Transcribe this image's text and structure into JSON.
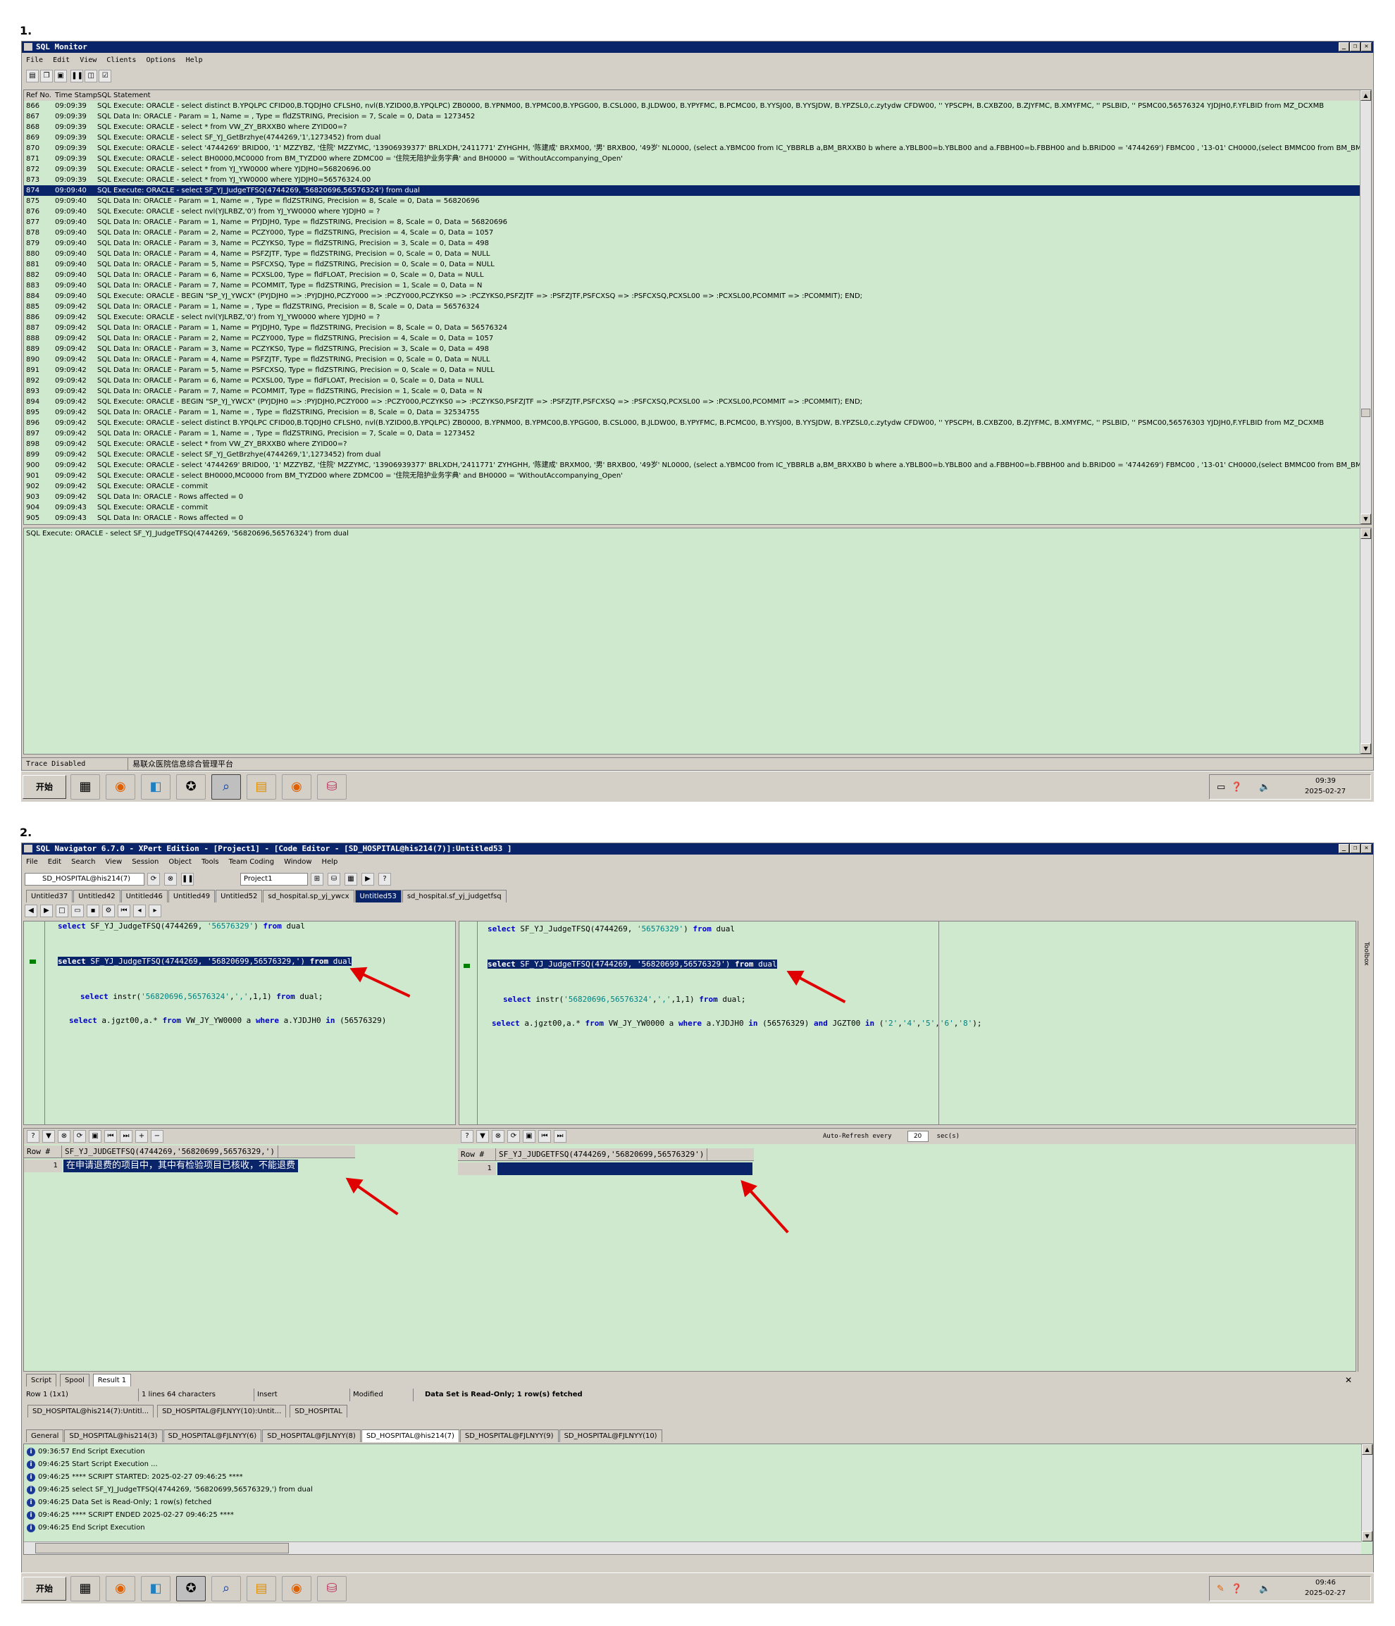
{
  "labels": {
    "one": "1.",
    "two": "2."
  },
  "monitor": {
    "title": "SQL Monitor",
    "menu": [
      "File",
      "Edit",
      "View",
      "Clients",
      "Options",
      "Help"
    ],
    "headers": [
      "Ref No.",
      "Time Stamp",
      "SQL Statement"
    ],
    "rows": [
      [
        "866",
        "09:09:39",
        "SQL Execute: ORACLE -    select distinct B.YPQLPC CFID00,B.TQDJH0 CFLSH0, nvl(B.YZID00,B.YPQLPC) ZB0000, B.YPNM00,   B.YPMC00,B.YPGG00, B.CSL000, B.JLDW00, B.YPYFMC, B.PCMC00, B.YYSJ00, B.YYSJDW,   B.YPZSL0,c.zytydw CFDW00, '' YPSCPH, B.CXBZ00, B.ZJYFMC, B.XMYFMC, '' PSLBID, '' PSMC00,56576324 YJDJH0,F.YFLBID   from MZ_DCXMB"
      ],
      [
        "867",
        "09:09:39",
        "SQL Data In: ORACLE - Param = 1, Name = , Type = fldZSTRING, Precision = 7, Scale = 0, Data = 1273452"
      ],
      [
        "868",
        "09:09:39",
        "SQL Execute: ORACLE - select * from VW_ZY_BRXXB0 where ZYID00=?"
      ],
      [
        "869",
        "09:09:39",
        "SQL Execute: ORACLE - select SF_YJ_GetBrzhye(4744269,'1',1273452) from dual"
      ],
      [
        "870",
        "09:09:39",
        "SQL Execute: ORACLE - select '4744269' BRID00, '1' MZZYBZ, '住院' MZZYMC, '13906939377' BRLXDH,'2411771' ZYHGHH, '陈建成' BRXM00, '男' BRXB00, '49岁' NL0000, (select a.YBMC00 from IC_YBBRLB a,BM_BRXXB0 b where a.YBLB00=b.YBLB00 and a.FBBH00=b.FBBH00 and b.BRID00 = '4744269') FBMC00 , '13-01' CH0000,(select BMMC00 from BM_BMBM00"
      ],
      [
        "871",
        "09:09:39",
        "SQL Execute: ORACLE - select BH0000,MC0000 from BM_TYZD00 where ZDMC00 = '住院无陪护业务字典' and BH0000 = 'WithoutAccompanying_Open'"
      ],
      [
        "872",
        "09:09:39",
        "SQL Execute: ORACLE - select * from YJ_YW0000 where YJDJH0=56820696.00"
      ],
      [
        "873",
        "09:09:39",
        "SQL Execute: ORACLE - select * from YJ_YW0000 where YJDJH0=56576324.00"
      ],
      [
        "874",
        "09:09:40",
        "SQL Execute: ORACLE - select SF_YJ_JudgeTFSQ(4744269, '56820696,56576324') from dual"
      ],
      [
        "875",
        "09:09:40",
        "SQL Data In: ORACLE - Param = 1, Name = , Type = fldZSTRING, Precision = 8, Scale = 0, Data = 56820696"
      ],
      [
        "876",
        "09:09:40",
        "SQL Execute: ORACLE - select nvl(YJLRBZ,'0') from YJ_YW0000 where YJDJH0 = ?"
      ],
      [
        "877",
        "09:09:40",
        "SQL Data In: ORACLE - Param = 1, Name = PYJDJH0, Type = fldZSTRING, Precision = 8, Scale = 0, Data = 56820696"
      ],
      [
        "878",
        "09:09:40",
        "SQL Data In: ORACLE - Param = 2, Name = PCZY000, Type = fldZSTRING, Precision = 4, Scale = 0, Data = 1057"
      ],
      [
        "879",
        "09:09:40",
        "SQL Data In: ORACLE - Param = 3, Name = PCZYKS0, Type = fldZSTRING, Precision = 3, Scale = 0, Data = 498"
      ],
      [
        "880",
        "09:09:40",
        "SQL Data In: ORACLE - Param = 4, Name = PSFZJTF, Type = fldZSTRING, Precision = 0, Scale = 0, Data = NULL"
      ],
      [
        "881",
        "09:09:40",
        "SQL Data In: ORACLE - Param = 5, Name = PSFCXSQ, Type = fldZSTRING, Precision = 0, Scale = 0, Data = NULL"
      ],
      [
        "882",
        "09:09:40",
        "SQL Data In: ORACLE - Param = 6, Name = PCXSL00, Type = fldFLOAT, Precision = 0, Scale = 0, Data = NULL"
      ],
      [
        "883",
        "09:09:40",
        "SQL Data In: ORACLE - Param = 7, Name = PCOMMIT, Type = fldZSTRING, Precision = 1, Scale = 0, Data = N"
      ],
      [
        "884",
        "09:09:40",
        "SQL Execute: ORACLE - BEGIN \"SP_YJ_YWCX\" (PYJDJH0 => :PYJDJH0,PCZY000 => :PCZY000,PCZYKS0 => :PCZYKS0,PSFZJTF => :PSFZJTF,PSFCXSQ => :PSFCXSQ,PCXSL00 => :PCXSL00,PCOMMIT => :PCOMMIT); END;"
      ],
      [
        "885",
        "09:09:42",
        "SQL Data In: ORACLE - Param = 1, Name = , Type = fldZSTRING, Precision = 8, Scale = 0, Data = 56576324"
      ],
      [
        "886",
        "09:09:42",
        "SQL Execute: ORACLE - select nvl(YJLRBZ,'0') from YJ_YW0000 where YJDJH0 = ?"
      ],
      [
        "887",
        "09:09:42",
        "SQL Data In: ORACLE - Param = 1, Name = PYJDJH0, Type = fldZSTRING, Precision = 8, Scale = 0, Data = 56576324"
      ],
      [
        "888",
        "09:09:42",
        "SQL Data In: ORACLE - Param = 2, Name = PCZY000, Type = fldZSTRING, Precision = 4, Scale = 0, Data = 1057"
      ],
      [
        "889",
        "09:09:42",
        "SQL Data In: ORACLE - Param = 3, Name = PCZYKS0, Type = fldZSTRING, Precision = 3, Scale = 0, Data = 498"
      ],
      [
        "890",
        "09:09:42",
        "SQL Data In: ORACLE - Param = 4, Name = PSFZJTF, Type = fldZSTRING, Precision = 0, Scale = 0, Data = NULL"
      ],
      [
        "891",
        "09:09:42",
        "SQL Data In: ORACLE - Param = 5, Name = PSFCXSQ, Type = fldZSTRING, Precision = 0, Scale = 0, Data = NULL"
      ],
      [
        "892",
        "09:09:42",
        "SQL Data In: ORACLE - Param = 6, Name = PCXSL00, Type = fldFLOAT, Precision = 0, Scale = 0, Data = NULL"
      ],
      [
        "893",
        "09:09:42",
        "SQL Data In: ORACLE - Param = 7, Name = PCOMMIT, Type = fldZSTRING, Precision = 1, Scale = 0, Data = N"
      ],
      [
        "894",
        "09:09:42",
        "SQL Execute: ORACLE - BEGIN \"SP_YJ_YWCX\" (PYJDJH0 => :PYJDJH0,PCZY000 => :PCZY000,PCZYKS0 => :PCZYKS0,PSFZJTF => :PSFZJTF,PSFCXSQ => :PSFCXSQ,PCXSL00 => :PCXSL00,PCOMMIT => :PCOMMIT); END;"
      ],
      [
        "895",
        "09:09:42",
        "SQL Data In: ORACLE - Param = 1, Name = , Type = fldZSTRING, Precision = 8, Scale = 0, Data = 32534755"
      ],
      [
        "896",
        "09:09:42",
        "SQL Execute: ORACLE -    select distinct B.YPQLPC CFID00,B.TQDJH0 CFLSH0, nvl(B.YZID00,B.YPQLPC) ZB0000, B.YPNM00,   B.YPMC00,B.YPGG00, B.CSL000, B.JLDW00, B.YPYFMC, B.PCMC00, B.YYSJ00, B.YYSJDW,   B.YPZSL0,c.zytydw CFDW00, '' YPSCPH, B.CXBZ00, B.ZJYFMC, B.XMYFMC, '' PSLBID, '' PSMC00,56576303 YJDJH0,F.YFLBID   from MZ_DCXMB"
      ],
      [
        "897",
        "09:09:42",
        "SQL Data In: ORACLE - Param = 1, Name = , Type = fldZSTRING, Precision = 7, Scale = 0, Data = 1273452"
      ],
      [
        "898",
        "09:09:42",
        "SQL Execute: ORACLE - select * from VW_ZY_BRXXB0 where ZYID00=?"
      ],
      [
        "899",
        "09:09:42",
        "SQL Execute: ORACLE - select SF_YJ_GetBrzhye(4744269,'1',1273452) from dual"
      ],
      [
        "900",
        "09:09:42",
        "SQL Execute: ORACLE - select '4744269' BRID00, '1' MZZYBZ, '住院' MZZYMC, '13906939377' BRLXDH,'2411771' ZYHGHH, '陈建成' BRXM00, '男' BRXB00, '49岁' NL0000, (select a.YBMC00 from IC_YBBRLB a,BM_BRXXB0 b where a.YBLB00=b.YBLB00 and a.FBBH00=b.FBBH00 and b.BRID00 = '4744269') FBMC00 , '13-01' CH0000,(select BMMC00 from BM_BMBM00"
      ],
      [
        "901",
        "09:09:42",
        "SQL Execute: ORACLE - select BH0000,MC0000 from BM_TYZD00 where ZDMC00 = '住院无陪护业务字典' and BH0000 = 'WithoutAccompanying_Open'"
      ],
      [
        "902",
        "09:09:42",
        "SQL Execute: ORACLE - commit"
      ],
      [
        "903",
        "09:09:42",
        "SQL Data In: ORACLE - Rows affected = 0"
      ],
      [
        "904",
        "09:09:43",
        "SQL Execute: ORACLE - commit"
      ],
      [
        "905",
        "09:09:43",
        "SQL Data In: ORACLE - Rows affected = 0"
      ]
    ],
    "detail": "SQL Execute: ORACLE - select SF_YJ_JudgeTFSQ(4744269, '56820696,56576324') from dual",
    "status_left": "Trace Disabled",
    "status_right": "易联众医院信息综合管理平台"
  },
  "taskbar1": {
    "start": "开始",
    "time": "09:39",
    "date": "2025-02-27"
  },
  "navigator": {
    "title": "SQL Navigator 6.7.0 - XPert Edition - [Project1] - [Code Editor - [SD_HOSPITAL@his214(7)]:Untitled53 ]",
    "menu": [
      "File",
      "Edit",
      "Search",
      "View",
      "Session",
      "Object",
      "Tools",
      "Team Coding",
      "Window",
      "Help"
    ],
    "connection": "SD_HOSPITAL@his214(7)",
    "project": "Project1",
    "tabs_left": [
      "Untitled37",
      "Untitled42",
      "Untitled46",
      "Untitled49",
      "Untitled52",
      "sd_hospital.sp_yj_ywcx"
    ],
    "tab_active": "Untitled53",
    "tab_right": "sd_hospital.sf_yj_judgetfsq",
    "left_code": {
      "l1": "select SF_YJ_JudgeTFSQ(4744269, '56576329') from dual",
      "l2": "select SF_YJ_JudgeTFSQ(4744269, '56820699,56576329,') from dual",
      "l3": "select instr('56820696,56576324',',',1,1)  from dual;",
      "l4": "select a.jgzt00,a.* from VW_JY_YW0000 a where a.YJDJH0 in (56576329)"
    },
    "right_code": {
      "l1": "select SF_YJ_JudgeTFSQ(4744269, '56576329') from dual",
      "l2": "select SF_YJ_JudgeTFSQ(4744269, '56820699,56576329') from dual",
      "l3": "select instr('56820696,56576324',',',1,1)  from dual;",
      "l4": "select a.jgzt00,a.* from VW_JY_YW0000 a where a.YJDJH0 in (56576329) and JGZT00 in ('2','4','5','6','8');"
    },
    "left_grid": {
      "h_row": "Row #",
      "h_col": "SF_YJ_JUDGETFSQ(4744269,'56820699,56576329,')",
      "row_no": "1",
      "value": "在申请退费的项目中，其中有检验项目已核收，不能退费"
    },
    "right_grid": {
      "h_row": "Row #",
      "h_col": "SF_YJ_JUDGETFSQ(4744269,'56820699,56576329')",
      "row_no": "1",
      "value": ""
    },
    "auto_refresh": {
      "label": "Auto-Refresh every",
      "value": "20",
      "unit": "sec(s)"
    },
    "toolbox": "Toolbox",
    "bottom_tabs": [
      "Script",
      "Spool",
      "Result 1"
    ],
    "status": [
      "Row 1 (1x1)",
      "1 lines 64 characters",
      "Insert",
      "Modified",
      "Data Set is Read-Only; 1 row(s) fetched"
    ],
    "conn_tabs": [
      "SD_HOSPITAL@his214(7):Untitl...",
      "SD_HOSPITAL@FJLNYY(10):Untit...",
      "SD_HOSPITAL"
    ],
    "output_tabs": [
      "General",
      "SD_HOSPITAL@his214(3)",
      "SD_HOSPITAL@FJLNYY(6)",
      "SD_HOSPITAL@FJLNYY(8)",
      "SD_HOSPITAL@his214(7)",
      "SD_HOSPITAL@FJLNYY(9)",
      "SD_HOSPITAL@FJLNYY(10)"
    ],
    "messages": [
      "09:36:57  End Script Execution",
      "09:46:25  Start Script Execution ...",
      "09:46:25  **** SCRIPT STARTED: 2025-02-27 09:46:25 ****",
      "09:46:25  select SF_YJ_JudgeTFSQ(4744269, '56820699,56576329,') from dual",
      "09:46:25  Data Set is Read-Only; 1 row(s) fetched",
      "09:46:25  **** SCRIPT ENDED 2025-02-27 09:46:25 ****",
      "09:46:25  End Script Execution"
    ]
  },
  "taskbar2": {
    "start": "开始",
    "time": "09:46",
    "date": "2025-02-27"
  },
  "colors": {
    "titlebar": "#0a246a",
    "green": "#cfe9cf",
    "arrow": "#e00000"
  }
}
